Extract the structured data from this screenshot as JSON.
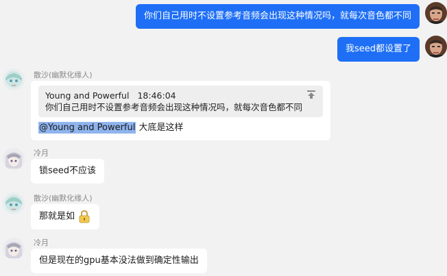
{
  "messages": [
    {
      "id": "m1",
      "side": "right",
      "text": "你们自己用时不设置参考音频会出现这种情况吗，就每次音色都不同"
    },
    {
      "id": "m2",
      "side": "right",
      "text": "我seed都设置了"
    },
    {
      "id": "m3",
      "side": "left",
      "sender": "散沙(幽默化缘人)",
      "quote": {
        "author": "Young and Powerful",
        "time": "18:46:04",
        "text": "你们自己用时不设置参考音频会出现这种情况吗，就每次音色都不同"
      },
      "mention": "@Young and Powerful",
      "text": " 大底是这样"
    },
    {
      "id": "m4",
      "side": "left",
      "sender": "冷月",
      "text": "锁seed不应该"
    },
    {
      "id": "m5",
      "side": "left",
      "sender": "散沙(幽默化缘人)",
      "text": "那就是如",
      "emoji": "lock-icon"
    },
    {
      "id": "m6",
      "side": "left",
      "sender": "冷月",
      "text": "但是现在的gpu基本没法做到确定性输出"
    }
  ],
  "colors": {
    "self_bubble": "#1e6ff6",
    "other_bubble": "#ffffff",
    "background": "#f2f2f2",
    "mention_highlight": "#8fb4ee"
  }
}
